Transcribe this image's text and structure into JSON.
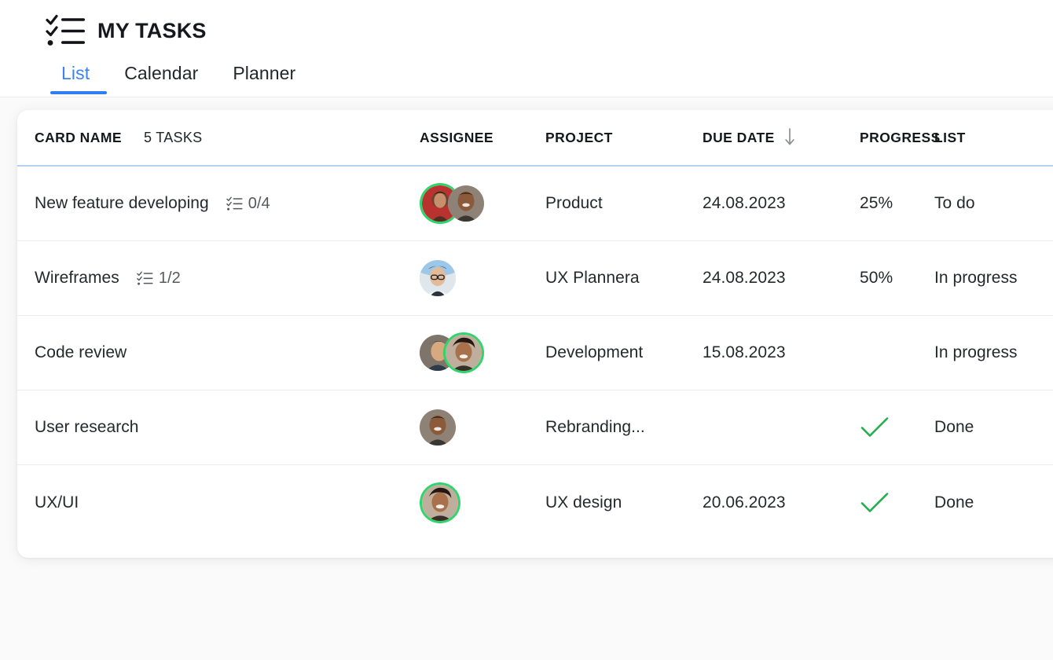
{
  "header": {
    "title": "MY TASKS",
    "logo_icon": "checklist-icon"
  },
  "tabs": [
    {
      "label": "List",
      "active": true
    },
    {
      "label": "Calendar",
      "active": false
    },
    {
      "label": "Planner",
      "active": false
    }
  ],
  "table": {
    "columns": {
      "card_name": "CARD NAME",
      "task_count": "5 TASKS",
      "assignee": "ASSIGNEE",
      "project": "PROJECT",
      "due_date": "DUE DATE",
      "due_date_sort_icon": "arrow-down-icon",
      "progress": "PROGRESS",
      "list": "LIST"
    },
    "rows": [
      {
        "name": "New feature developing",
        "checklist": "0/4",
        "has_checklist": true,
        "assignees": [
          {
            "variant": "female-1",
            "online": true
          },
          {
            "variant": "male-1",
            "online": false
          }
        ],
        "project": "Product",
        "due_date": "24.08.2023",
        "progress": "25%",
        "progress_done": false,
        "list": "To do"
      },
      {
        "name": "Wireframes",
        "checklist": "1/2",
        "has_checklist": true,
        "assignees": [
          {
            "variant": "male-glasses",
            "online": false
          }
        ],
        "project": "UX Plannera",
        "due_date": "24.08.2023",
        "progress": "50%",
        "progress_done": false,
        "list": "In progress"
      },
      {
        "name": "Code review",
        "checklist": "",
        "has_checklist": false,
        "assignees": [
          {
            "variant": "male-2",
            "online": false
          },
          {
            "variant": "female-2",
            "online": true
          }
        ],
        "project": "Development",
        "due_date": "15.08.2023",
        "progress": "",
        "progress_done": false,
        "list": "In progress"
      },
      {
        "name": "User research",
        "checklist": "",
        "has_checklist": false,
        "assignees": [
          {
            "variant": "male-1",
            "online": false
          }
        ],
        "project": "Rebranding...",
        "due_date": "",
        "progress": "",
        "progress_done": true,
        "list": "Done"
      },
      {
        "name": "UX/UI",
        "checklist": "",
        "has_checklist": false,
        "assignees": [
          {
            "variant": "female-2",
            "online": true
          }
        ],
        "project": "UX design",
        "due_date": "20.06.2023",
        "progress": "",
        "progress_done": true,
        "list": "Done"
      }
    ]
  },
  "colors": {
    "accent_blue": "#2f7ef5",
    "tab_active": "#3b82f6",
    "online_ring": "#2fd46a",
    "done_check": "#22b04a",
    "header_underline": "#b7d0f2",
    "row_divider": "#ededed",
    "page_bg": "#fafafa",
    "text": "#25282d"
  }
}
